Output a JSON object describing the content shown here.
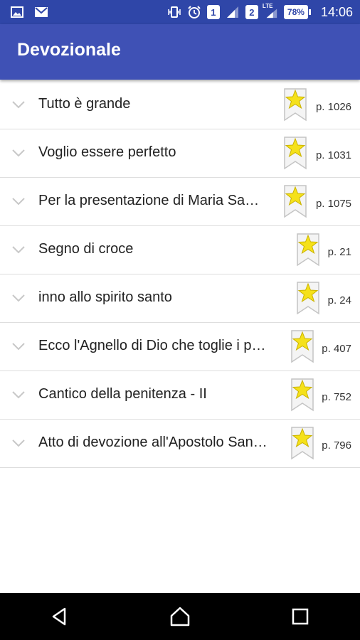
{
  "status_bar": {
    "sim1": "1",
    "sim2": "2",
    "network_type": "LTE",
    "battery": "78%",
    "time": "14:06"
  },
  "app_bar": {
    "title": "Devozionale"
  },
  "items": [
    {
      "title": "Tutto è grande",
      "page": "p. 1026"
    },
    {
      "title": "Voglio essere perfetto",
      "page": "p. 1031"
    },
    {
      "title": "Per la presentazione di Maria Sa…",
      "page": "p. 1075"
    },
    {
      "title": "Segno di croce",
      "page": "p. 21"
    },
    {
      "title": "inno allo spirito santo",
      "page": "p. 24"
    },
    {
      "title": "Ecco l'Agnello di Dio che toglie i p…",
      "page": "p. 407"
    },
    {
      "title": "Cantico della penitenza - II",
      "page": "p. 752"
    },
    {
      "title": "Atto di devozione all'Apostolo San…",
      "page": "p. 796"
    }
  ],
  "colors": {
    "app_bar": "#3f51b5",
    "status_bar": "#2f46a8",
    "star": "#f5e11a",
    "nav_bar": "#000000"
  }
}
